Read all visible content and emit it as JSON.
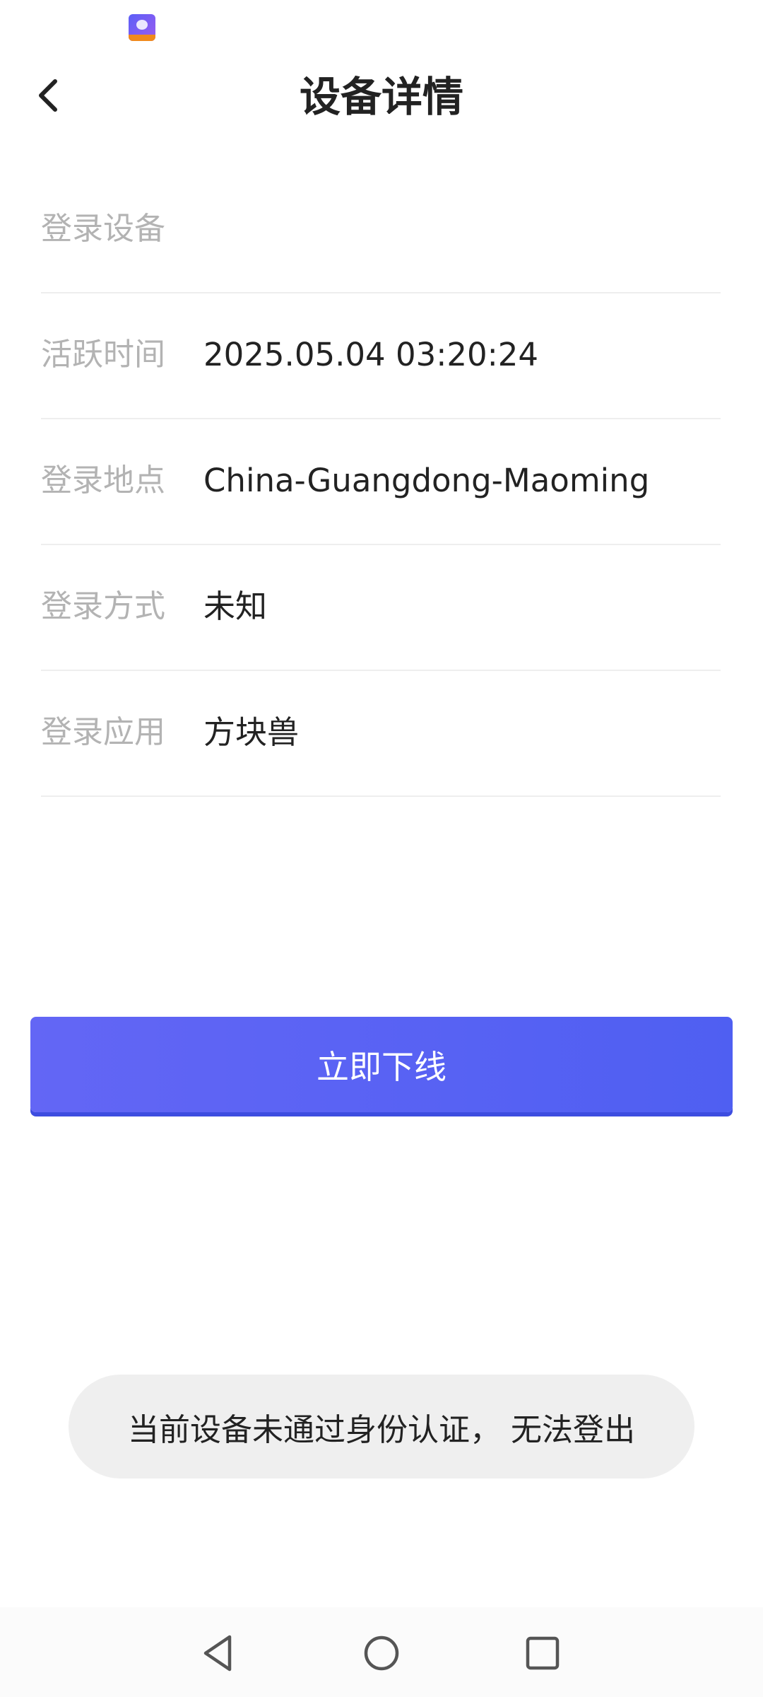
{
  "header": {
    "title": "设备详情"
  },
  "info_rows": [
    {
      "label": "登录设备",
      "value": ""
    },
    {
      "label": "活跃时间",
      "value": "2025.05.04 03:20:24"
    },
    {
      "label": "登录地点",
      "value": "China-Guangdong-Maoming"
    },
    {
      "label": "登录方式",
      "value": "未知"
    },
    {
      "label": "登录应用",
      "value": "方块兽"
    }
  ],
  "actions": {
    "logout_label": "立即下线"
  },
  "toast": {
    "message": "当前设备未通过身份认证， 无法登出"
  },
  "colors": {
    "accent": "#5a61f4",
    "label_gray": "#b3b3b3",
    "text_dark": "#222222",
    "toast_bg": "#efefef"
  },
  "icons": {
    "back": "chevron-left-icon",
    "status_app": "app-notification-icon",
    "nav_back": "triangle-back-icon",
    "nav_home": "circle-home-icon",
    "nav_recent": "square-recent-icon"
  }
}
